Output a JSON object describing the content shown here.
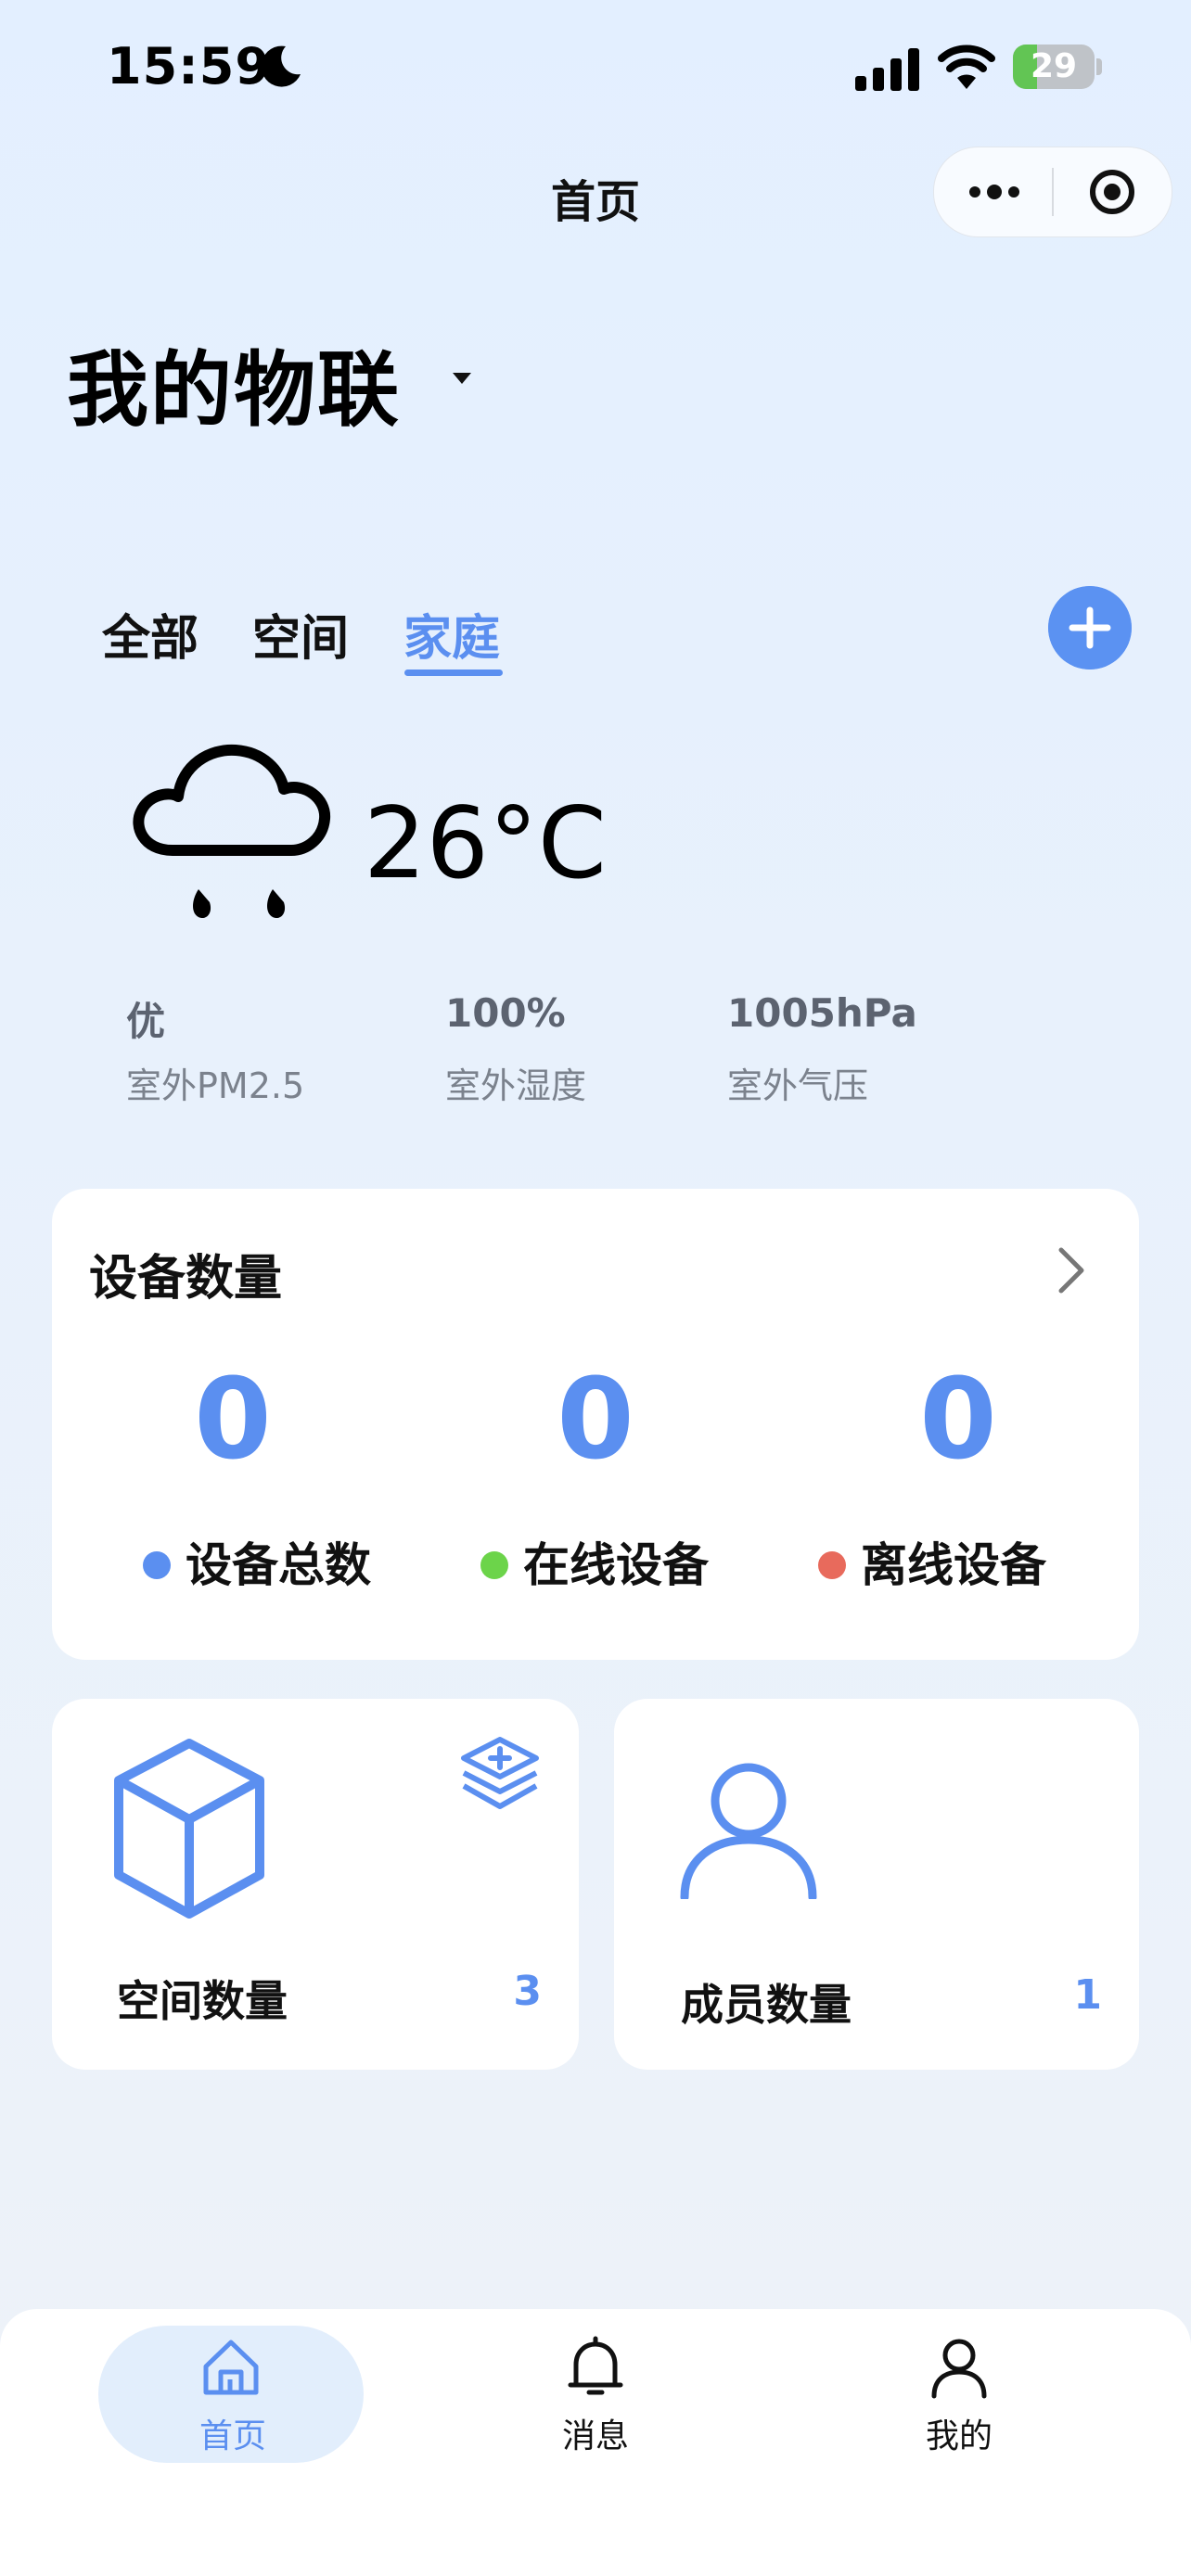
{
  "status_bar": {
    "time": "15:59",
    "battery": "29",
    "battery_level": 0.29,
    "icons": [
      "moon-icon",
      "cellular-signal-icon",
      "wifi-icon",
      "battery-icon"
    ]
  },
  "nav": {
    "title": "首页",
    "more_icon": "more-dots-icon",
    "close_icon": "target-close-icon"
  },
  "header": {
    "title": "我的物联"
  },
  "tabs": [
    {
      "label": "全部",
      "active": false
    },
    {
      "label": "空间",
      "active": false
    },
    {
      "label": "家庭",
      "active": true
    }
  ],
  "weather": {
    "icon": "rain-cloud-icon",
    "temperature": "26°C",
    "metrics": [
      {
        "value": "优",
        "label": "室外PM2.5"
      },
      {
        "value": "100%",
        "label": "室外湿度"
      },
      {
        "value": "1005hPa",
        "label": "室外气压"
      }
    ]
  },
  "devices": {
    "title": "设备数量",
    "counts": [
      {
        "value": "0",
        "label": "设备总数",
        "color": "#5b8ff0"
      },
      {
        "value": "0",
        "label": "在线设备",
        "color": "#6cd44a"
      },
      {
        "value": "0",
        "label": "离线设备",
        "color": "#e86a5c"
      }
    ]
  },
  "spaces": {
    "title": "空间数量",
    "value": "3"
  },
  "members": {
    "title": "成员数量",
    "value": "1"
  },
  "tabbar": [
    {
      "label": "首页",
      "icon": "home-icon",
      "active": true
    },
    {
      "label": "消息",
      "icon": "bell-icon",
      "active": false
    },
    {
      "label": "我的",
      "icon": "person-icon",
      "active": false
    }
  ],
  "colors": {
    "accent": "#5b8ff0",
    "online": "#6cd44a",
    "offline": "#e86a5c"
  }
}
